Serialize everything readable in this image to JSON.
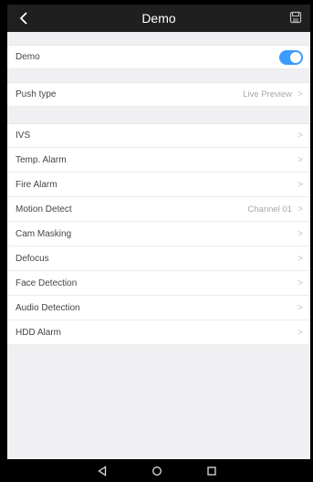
{
  "header": {
    "title": "Demo",
    "back_icon": "back-chevron-icon",
    "save_icon": "save-icon"
  },
  "demo_row": {
    "label": "Demo",
    "toggle_on": true,
    "toggle_color": "#3b9bff"
  },
  "push_row": {
    "label": "Push type",
    "value": "Live Preview"
  },
  "alarms": [
    {
      "label": "IVS",
      "value": ""
    },
    {
      "label": "Temp. Alarm",
      "value": ""
    },
    {
      "label": "Fire Alarm",
      "value": ""
    },
    {
      "label": "Motion Detect",
      "value": "Channel 01"
    },
    {
      "label": "Cam Masking",
      "value": ""
    },
    {
      "label": "Defocus",
      "value": ""
    },
    {
      "label": "Face Detection",
      "value": ""
    },
    {
      "label": "Audio Detection",
      "value": ""
    },
    {
      "label": "HDD Alarm",
      "value": ""
    }
  ],
  "chevron": ">",
  "nav": {
    "back": "nav-back-icon",
    "home": "nav-home-icon",
    "recents": "nav-recents-icon"
  }
}
